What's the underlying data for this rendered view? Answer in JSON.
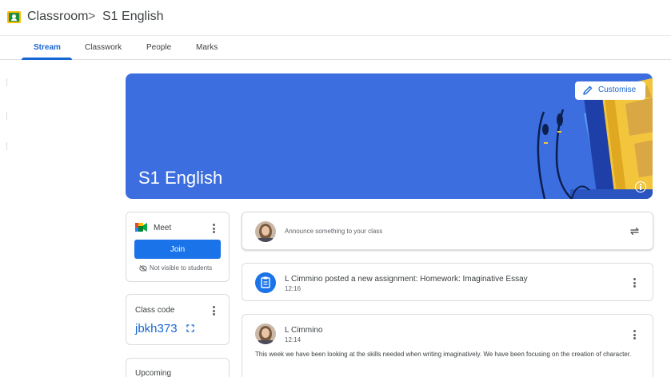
{
  "header": {
    "app_title": "Classroom",
    "separator": ">",
    "class_name": "S1 English"
  },
  "tabs": [
    {
      "label": "Stream",
      "active": true
    },
    {
      "label": "Classwork",
      "active": false
    },
    {
      "label": "People",
      "active": false
    },
    {
      "label": "Marks",
      "active": false
    }
  ],
  "banner": {
    "title": "S1 English",
    "customise_label": "Customise",
    "background_color": "#3c6ee0",
    "icons": [
      "pencil-icon",
      "info-icon"
    ]
  },
  "meet": {
    "label": "Meet",
    "join_label": "Join",
    "visibility_note": "Not visible to students"
  },
  "class_code": {
    "title": "Class code",
    "code": "jbkh373"
  },
  "upcoming": {
    "title": "Upcoming"
  },
  "announce": {
    "placeholder": "Announce something to your class"
  },
  "stream": [
    {
      "type": "assignment",
      "title": "L Cimmino posted a new assignment: Homework: Imaginative Essay",
      "time": "12:16"
    },
    {
      "type": "post",
      "author": "L Cimmino",
      "time": "12:14",
      "body": "This week we have been looking at the skills needed when writing imaginatively. We have been focusing on the creation of character."
    }
  ],
  "colors": {
    "accent": "#1967d2",
    "primary_button": "#1a73e8",
    "text": "#3c4043"
  }
}
